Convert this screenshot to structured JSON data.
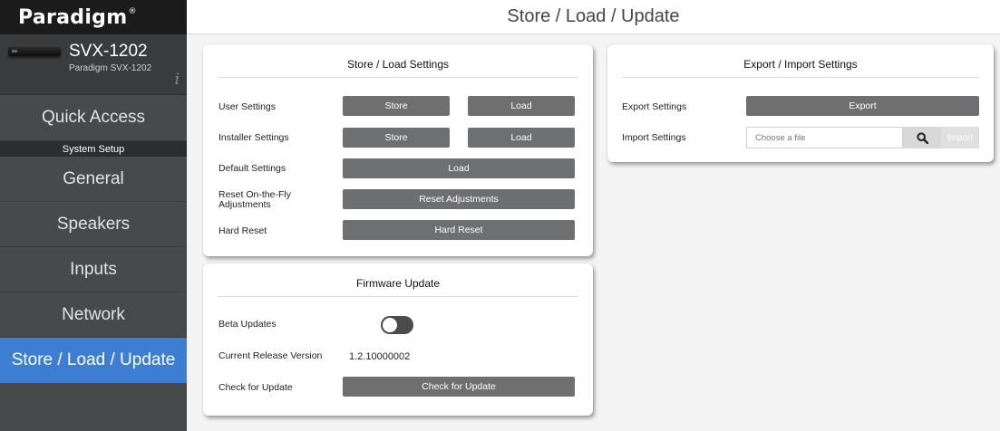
{
  "brand": {
    "name": "Paradigm",
    "mark": "®"
  },
  "device": {
    "name": "SVX-1202",
    "subtitle": "Paradigm SVX-1202",
    "info_icon": "info-icon"
  },
  "nav": {
    "quick_access": "Quick Access",
    "section_header": "System Setup",
    "items": [
      {
        "label": "General"
      },
      {
        "label": "Speakers"
      },
      {
        "label": "Inputs"
      },
      {
        "label": "Network"
      },
      {
        "label": "Store / Load / Update",
        "active": true
      }
    ]
  },
  "header": {
    "title": "Store / Load / Update"
  },
  "store_load": {
    "title": "Store / Load Settings",
    "rows": [
      {
        "label": "User Settings",
        "buttons": [
          "Store",
          "Load"
        ]
      },
      {
        "label": "Installer Settings",
        "buttons": [
          "Store",
          "Load"
        ]
      },
      {
        "label": "Default Settings",
        "buttons": [
          "Load"
        ]
      },
      {
        "label": "Reset On-the-Fly Adjustments",
        "buttons": [
          "Reset Adjustments"
        ]
      },
      {
        "label": "Hard Reset",
        "buttons": [
          "Hard Reset"
        ]
      }
    ]
  },
  "firmware": {
    "title": "Firmware Update",
    "beta_label": "Beta Updates",
    "beta_enabled": false,
    "version_label": "Current Release Version",
    "version_value": "1.2.10000002",
    "check_label": "Check for Update",
    "check_button": "Check for Update"
  },
  "export_import": {
    "title": "Export / Import Settings",
    "export_label": "Export Settings",
    "export_button": "Export",
    "import_label": "Import Settings",
    "file_placeholder": "Choose a file",
    "search_icon": "search-icon",
    "import_button": "Import"
  },
  "colors": {
    "sidebar": "#48494b",
    "brand_bar": "#1b1b1c",
    "active_nav": "#3d7ed3",
    "button": "#6e6f71"
  }
}
